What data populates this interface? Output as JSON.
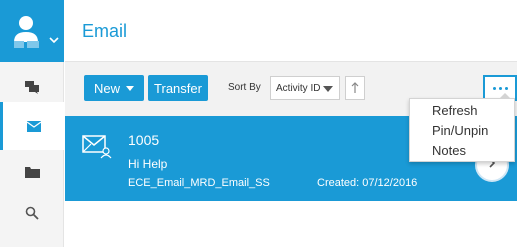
{
  "header": {
    "title": "Email"
  },
  "sidebar": {
    "items": [
      {
        "name": "chat",
        "icon": "chat-icon"
      },
      {
        "name": "email",
        "icon": "envelope-icon",
        "active": true
      },
      {
        "name": "folder",
        "icon": "folder-icon"
      },
      {
        "name": "search",
        "icon": "search-icon"
      }
    ]
  },
  "toolbar": {
    "new_label": "New",
    "transfer_label": "Transfer",
    "sort_label": "Sort By",
    "sort_value": "Activity ID",
    "more_label": "..."
  },
  "activity": {
    "id": "1005",
    "subject": "Hi Help",
    "address": "ECE_Email_MRD_Email_SS",
    "created": "Created: 07/12/2016"
  },
  "menu": {
    "items": [
      "Refresh",
      "Pin/Unpin",
      "Notes"
    ]
  },
  "colors": {
    "accent": "#1a9ad6",
    "sidebar_bg": "#f4f4f4",
    "toolbar_bg": "#f2f2f2"
  }
}
